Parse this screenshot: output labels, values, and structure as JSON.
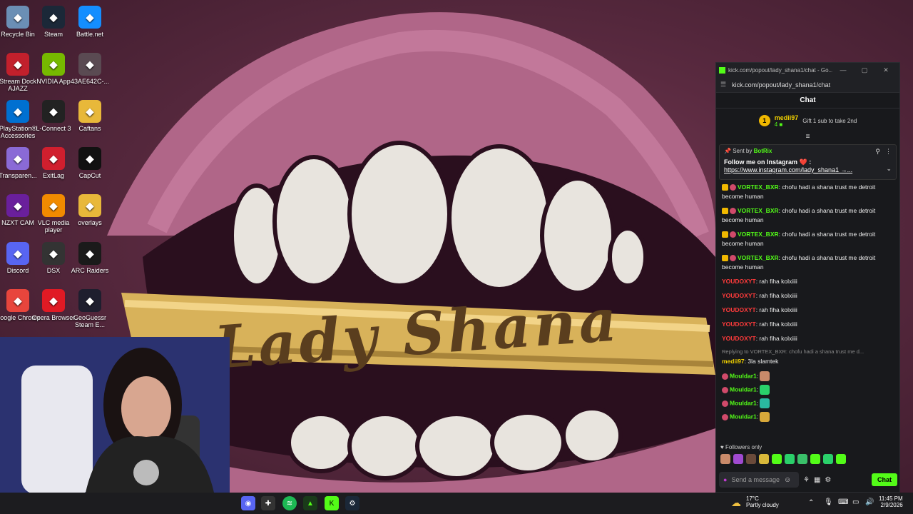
{
  "desktop_icons": [
    {
      "label": "Recycle Bin",
      "icon": "recycle-bin-icon",
      "color": "#6b8fb5"
    },
    {
      "label": "Steam",
      "icon": "steam-icon",
      "color": "#1b2838"
    },
    {
      "label": "Battle.net",
      "icon": "battlenet-icon",
      "color": "#148eff"
    },
    {
      "label": "Stream Dock AJAZZ",
      "icon": "stream-dock-icon",
      "color": "#c2202c"
    },
    {
      "label": "NVIDIA App",
      "icon": "nvidia-icon",
      "color": "#76b900"
    },
    {
      "label": "43AE642C-...",
      "icon": "image-file-icon",
      "color": "#5a4a52"
    },
    {
      "label": "PlayStation® Accessories",
      "icon": "playstation-icon",
      "color": "#0070d1"
    },
    {
      "label": "L-Connect 3",
      "icon": "lconnect-icon",
      "color": "#222222"
    },
    {
      "label": "Caftans",
      "icon": "folder-icon",
      "color": "#e8b83a"
    },
    {
      "label": "Transparen...",
      "icon": "chat-bubble-icon",
      "color": "#8a6ad6"
    },
    {
      "label": "ExitLag",
      "icon": "exitlag-icon",
      "color": "#d01f2e"
    },
    {
      "label": "CapCut",
      "icon": "capcut-icon",
      "color": "#111111"
    },
    {
      "label": "NZXT CAM",
      "icon": "nzxt-icon",
      "color": "#6a1f9c"
    },
    {
      "label": "VLC media player",
      "icon": "vlc-icon",
      "color": "#f18a00"
    },
    {
      "label": "overlays",
      "icon": "folder-icon",
      "color": "#e8b83a"
    },
    {
      "label": "Discord",
      "icon": "discord-icon",
      "color": "#5865f2"
    },
    {
      "label": "DSX",
      "icon": "dsx-icon",
      "color": "#333333"
    },
    {
      "label": "ARC Raiders",
      "icon": "arc-raiders-icon",
      "color": "#1a1a1a"
    },
    {
      "label": "Google Chrome",
      "icon": "chrome-icon",
      "color": "#e8453c"
    },
    {
      "label": "Opera Browser",
      "icon": "opera-icon",
      "color": "#e01a24"
    },
    {
      "label": "GeoGuessr Steam E...",
      "icon": "geoguessr-icon",
      "color": "#1e1e2e"
    }
  ],
  "wallpaper": {
    "text": "Lady Shana"
  },
  "chat_window": {
    "title": "kick.com/popout/lady_shana1/chat - Go...",
    "url": "kick.com/popout/lady_shana1/chat",
    "header": "Chat",
    "leader": {
      "rank": "1",
      "name": "medii97",
      "count": "4",
      "gift": "Gift 1 sub to take 2nd"
    },
    "pinned": {
      "sent_by_label": "Sent by",
      "sender": "BotRix",
      "message": "Follow me on Instagram ❤️ :",
      "link": "https://www.instagram.com/lady_shana1 →..."
    },
    "messages": [
      {
        "user": "VORTEX_BXR",
        "color": "green",
        "text": ": chofu hadi a shana trust me detroit become human"
      },
      {
        "user": "VORTEX_BXR",
        "color": "green",
        "text": ": chofu hadi a shana trust me detroit become human"
      },
      {
        "user": "VORTEX_BXR",
        "color": "green",
        "text": ": chofu hadi a shana trust me detroit become human"
      },
      {
        "user": "VORTEX_BXR",
        "color": "green",
        "text": ": chofu hadi a shana trust me detroit become human"
      },
      {
        "user": "YOUDOXYT",
        "color": "red",
        "text": ": rah fiha kolxiiii"
      },
      {
        "user": "YOUDOXYT",
        "color": "red",
        "text": ": rah fiha kolxiiii"
      },
      {
        "user": "YOUDOXYT",
        "color": "red",
        "text": ": rah fiha kolxiiii"
      },
      {
        "user": "YOUDOXYT",
        "color": "red",
        "text": ": rah fiha kolxiiii"
      },
      {
        "user": "YOUDOXYT",
        "color": "red",
        "text": ": rah fiha kolxiiii"
      }
    ],
    "reply": {
      "context": "Replying to VORTEX_BXR: chofu hadi a shana trust me d...",
      "user": "medii97",
      "text": ": 3la slamtek"
    },
    "emote_messages": [
      {
        "user": "Mouldar1",
        "text": ":"
      },
      {
        "user": "Mouldar1",
        "text": ":"
      },
      {
        "user": "Mouldar1",
        "text": ":"
      },
      {
        "user": "Mouldar1",
        "text": ":"
      }
    ],
    "followers_only": "Followers only",
    "input_placeholder": "Send a message",
    "chat_button": "Chat"
  },
  "taskbar": {
    "weather_temp": "17°C",
    "weather_desc": "Partly cloudy",
    "time": "11:45 PM",
    "date": "2/9/2026"
  }
}
